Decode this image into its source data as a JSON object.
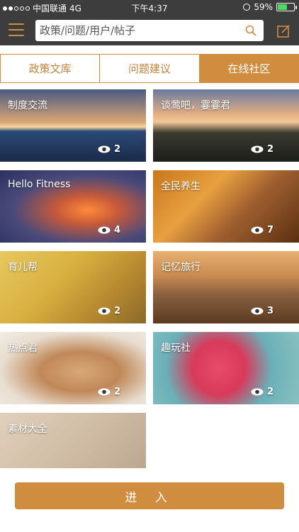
{
  "status_bar": {
    "carrier": "中国联通",
    "network": "4G",
    "time": "下午4:37",
    "battery": "59%",
    "battery_level": 0.59
  },
  "header": {
    "search_placeholder": "政策/问题/用户/帖子"
  },
  "tabs": [
    {
      "label": "政策文库",
      "active": false
    },
    {
      "label": "问题建议",
      "active": false
    },
    {
      "label": "在线社区",
      "active": true
    }
  ],
  "communities": [
    {
      "title": "制度交流",
      "views": "2"
    },
    {
      "title": "谈莺吧，霎霎君",
      "views": "2"
    },
    {
      "title": "Hello Fitness",
      "views": "4"
    },
    {
      "title": "全民养生",
      "views": "7"
    },
    {
      "title": "育儿帮",
      "views": "2"
    },
    {
      "title": "记忆旅行",
      "views": "3"
    },
    {
      "title": "热点君",
      "views": "2"
    },
    {
      "title": "趣玩社",
      "views": "2"
    },
    {
      "title": "素材大全",
      "views": ""
    }
  ],
  "footer": {
    "enter_label": "进 入"
  },
  "colors": {
    "accent": "#d08c3f",
    "header_bg": "#3d3d3d"
  }
}
